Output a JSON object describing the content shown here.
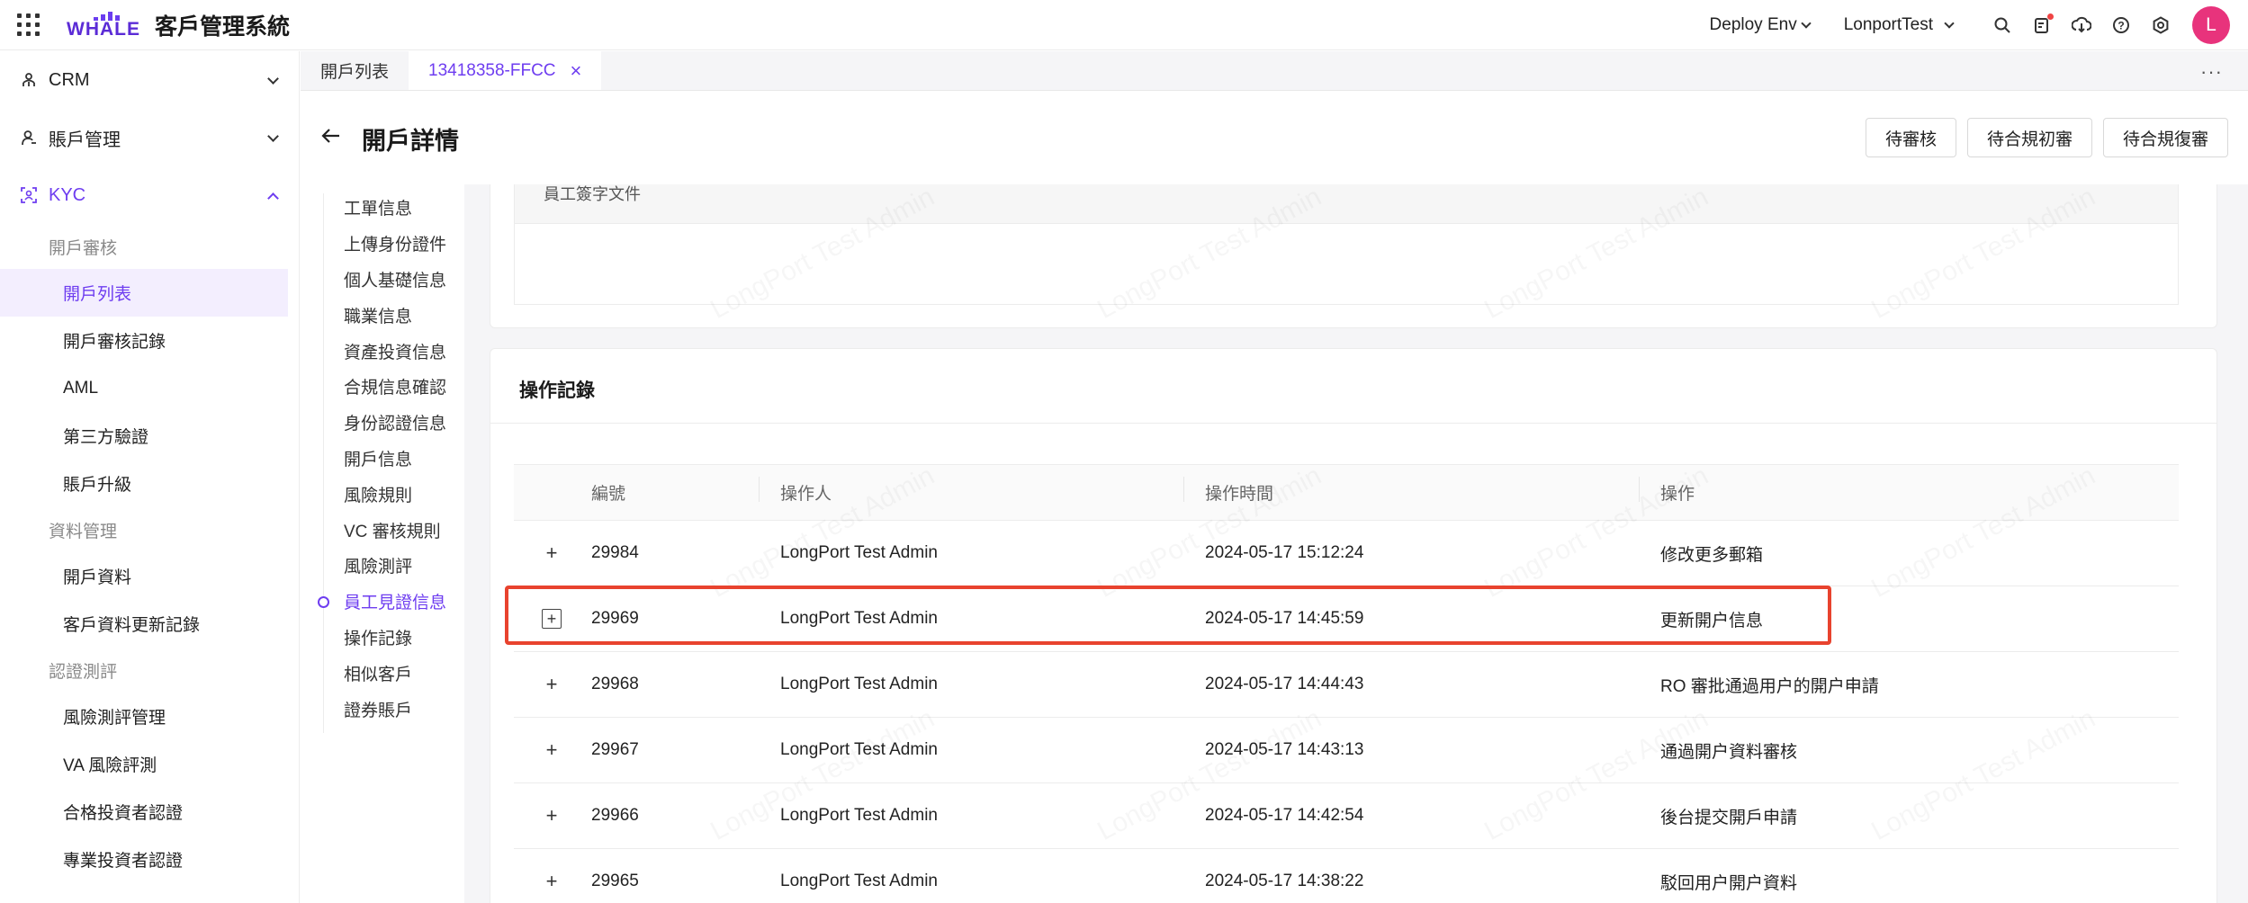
{
  "header": {
    "logo_text": "WHALE",
    "app_title": "客戶管理系統",
    "env_dropdown": "Deploy Env",
    "tenant_dropdown": "LonportTest",
    "avatar_letter": "L",
    "icons": [
      "search-icon",
      "task-icon",
      "download-icon",
      "help-icon",
      "settings-icon"
    ]
  },
  "sidebar": {
    "groups": [
      {
        "label": "CRM",
        "icon": "crm-icon"
      },
      {
        "label": "賬戶管理",
        "icon": "user-icon"
      },
      {
        "label": "KYC",
        "icon": "kyc-icon"
      }
    ],
    "sections": [
      {
        "title": "開戶審核",
        "items": [
          "開戶列表",
          "開戶審核記錄",
          "AML",
          "第三方驗證",
          "賬戶升級"
        ]
      },
      {
        "title": "資料管理",
        "items": [
          "開戶資料",
          "客戶資料更新記錄"
        ]
      },
      {
        "title": "認證測評",
        "items": [
          "風險測評管理",
          "VA 風險評測",
          "合格投資者認證",
          "專業投資者認證"
        ]
      }
    ],
    "active_item": "開戶列表"
  },
  "tabs": [
    {
      "label": "開戶列表"
    },
    {
      "label": "13418358-FFCC",
      "close": "×"
    }
  ],
  "tabs_more": "···",
  "page": {
    "title": "開戶詳情",
    "buttons": [
      "待審核",
      "待合規初審",
      "待合規復審"
    ]
  },
  "anchors": [
    "工單信息",
    "上傳身份證件",
    "個人基礎信息",
    "職業信息",
    "資產投資信息",
    "合規信息確認",
    "身份認證信息",
    "開戶信息",
    "風險規則",
    "VC 審核規則",
    "風險測評",
    "員工見證信息",
    "操作記錄",
    "相似客戶",
    "證券賬戶"
  ],
  "active_anchor": "員工見證信息",
  "signature_section": {
    "label": "員工簽字文件"
  },
  "log": {
    "title": "操作記錄",
    "columns": [
      "編號",
      "操作人",
      "操作時間",
      "操作"
    ],
    "rows": [
      {
        "expand": "+",
        "id": "29984",
        "operator": "LongPort Test Admin",
        "time": "2024-05-17 15:12:24",
        "action": "修改更多郵箱"
      },
      {
        "expand": "+",
        "id": "29969",
        "operator": "LongPort Test Admin",
        "time": "2024-05-17 14:45:59",
        "action": "更新開户信息"
      },
      {
        "expand": "+",
        "id": "29968",
        "operator": "LongPort Test Admin",
        "time": "2024-05-17 14:44:43",
        "action": "RO 審批通過用户的開户申請"
      },
      {
        "expand": "+",
        "id": "29967",
        "operator": "LongPort Test Admin",
        "time": "2024-05-17 14:43:13",
        "action": "通過開户資料審核"
      },
      {
        "expand": "+",
        "id": "29966",
        "operator": "LongPort Test Admin",
        "time": "2024-05-17 14:42:54",
        "action": "後台提交開戶申請"
      },
      {
        "expand": "+",
        "id": "29965",
        "operator": "LongPort Test Admin",
        "time": "2024-05-17 14:38:22",
        "action": "駁回用户開户資料"
      }
    ]
  },
  "watermark": "LongPort Test Admin",
  "colors": {
    "accent": "#6e3df0",
    "highlight_border": "#e8432e",
    "avatar": "#e8337c"
  }
}
